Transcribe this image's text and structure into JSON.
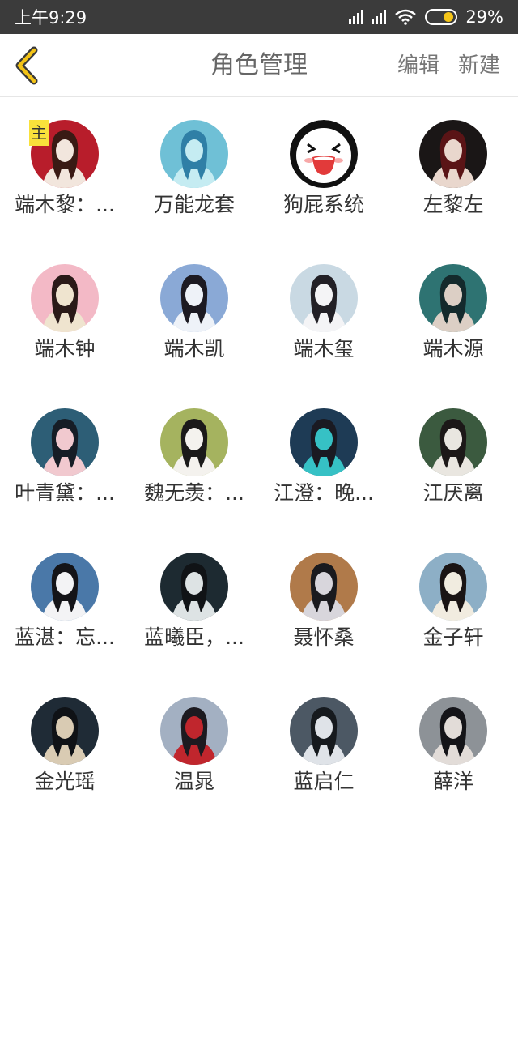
{
  "status_bar": {
    "time": "上午9:29",
    "battery": "29%"
  },
  "header": {
    "title": "角色管理",
    "edit_label": "编辑",
    "new_label": "新建"
  },
  "badge": "主",
  "characters": [
    {
      "name": "端木黎：...",
      "avatar": "avatar-photo",
      "colors": [
        "#b81d2b",
        "#f2e6dd",
        "#3a1a14"
      ]
    },
    {
      "name": "万能龙套",
      "avatar": "avatar-photo",
      "colors": [
        "#6fc0d6",
        "#c5ecf2",
        "#2f7fa6"
      ]
    },
    {
      "name": "狗屁系统",
      "avatar": "laughing-face-icon",
      "colors": [
        "#ffffff",
        "#e23a3a",
        "#111111"
      ]
    },
    {
      "name": "左黎左",
      "avatar": "avatar-photo",
      "colors": [
        "#1a1616",
        "#e9d7cd",
        "#5a1416"
      ]
    },
    {
      "name": "端木钟",
      "avatar": "avatar-photo",
      "colors": [
        "#f3b9c6",
        "#efe4cf",
        "#2a1a18"
      ]
    },
    {
      "name": "端木凯",
      "avatar": "avatar-photo",
      "colors": [
        "#8aa9d6",
        "#eef2f8",
        "#1c1a22"
      ]
    },
    {
      "name": "端木玺",
      "avatar": "avatar-photo",
      "colors": [
        "#c9d9e3",
        "#f4f4f6",
        "#222026"
      ]
    },
    {
      "name": "端木源",
      "avatar": "avatar-photo",
      "colors": [
        "#2e7372",
        "#dccfc5",
        "#142a2c"
      ]
    },
    {
      "name": "叶青黛：...",
      "avatar": "avatar-photo",
      "colors": [
        "#2d5e76",
        "#f1c9cf",
        "#161d26"
      ]
    },
    {
      "name": "魏无羡：...",
      "avatar": "avatar-photo",
      "colors": [
        "#a5b35f",
        "#f4f2ee",
        "#1b1a1a"
      ]
    },
    {
      "name": "江澄：晚...",
      "avatar": "avatar-photo",
      "colors": [
        "#1e3b55",
        "#36c1c5",
        "#1a1a22"
      ]
    },
    {
      "name": "江厌离",
      "avatar": "avatar-photo",
      "colors": [
        "#3b5a3f",
        "#e9e6e0",
        "#1c1818"
      ]
    },
    {
      "name": "蓝湛：忘...",
      "avatar": "avatar-photo",
      "colors": [
        "#4a78a8",
        "#f3f3f5",
        "#141418"
      ]
    },
    {
      "name": "蓝曦臣，...",
      "avatar": "avatar-photo",
      "colors": [
        "#1d2a31",
        "#dde3e4",
        "#101316"
      ]
    },
    {
      "name": "聂怀桑",
      "avatar": "avatar-photo",
      "colors": [
        "#b07a4a",
        "#d8d6dc",
        "#1a1a1e"
      ]
    },
    {
      "name": "金子轩",
      "avatar": "avatar-photo",
      "colors": [
        "#8dafc6",
        "#f1ece0",
        "#1a1414"
      ]
    },
    {
      "name": "金光瑶",
      "avatar": "avatar-photo",
      "colors": [
        "#1f2b36",
        "#d9cbb3",
        "#0f1216"
      ]
    },
    {
      "name": "温晁",
      "avatar": "avatar-photo",
      "colors": [
        "#a3b0c2",
        "#c0262d",
        "#1c1a20"
      ]
    },
    {
      "name": "蓝启仁",
      "avatar": "avatar-photo",
      "colors": [
        "#4c5864",
        "#dfe3e8",
        "#161a1e"
      ]
    },
    {
      "name": "薛洋",
      "avatar": "avatar-photo",
      "colors": [
        "#8d9297",
        "#e2dcd8",
        "#141418"
      ]
    }
  ]
}
